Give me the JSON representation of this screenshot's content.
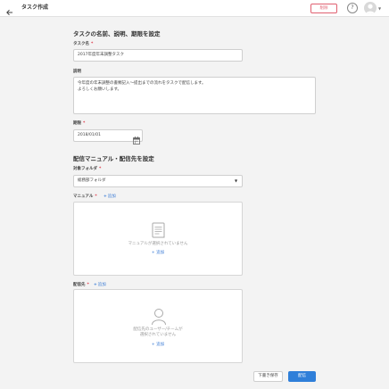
{
  "header": {
    "title": "タスク作成",
    "delete_label": "削除",
    "help_label": "?"
  },
  "section1": {
    "title": "タスクの名前、説明、期限を設定",
    "task_name_label": "タスク名",
    "task_name_value": "2017年度年末調整タスク",
    "description_label": "説明",
    "description_value": "今年度の年末調整の書類記入～提出までの流れをタスクで配信します。\nよろしくお願いします。",
    "due_label": "期限",
    "due_value": "2018/01/01"
  },
  "section2": {
    "title": "配信マニュアル・配信先を設定",
    "folder_label": "対象フォルダ",
    "folder_value": "総務部フォルダ",
    "manual_label": "マニュアル",
    "manual_add": "追加",
    "manual_empty": "マニュアルが選択されていません",
    "manual_box_add": "追加",
    "recipient_label": "配信先",
    "recipient_add": "追加",
    "recipient_empty_line1": "配信先のユーザー/チームが",
    "recipient_empty_line2": "選択されていません",
    "recipient_box_add": "追加"
  },
  "footer": {
    "draft_label": "下書き保存",
    "publish_label": "配信"
  },
  "colors": {
    "accent": "#2f7fd9",
    "link": "#3a7bd5",
    "danger": "#e06070",
    "required": "#e04050"
  },
  "icons": [
    "back-arrow-icon",
    "help-icon",
    "avatar",
    "calendar-icon",
    "chevron-down-icon",
    "document-icon",
    "user-icon",
    "plus-icon"
  ]
}
